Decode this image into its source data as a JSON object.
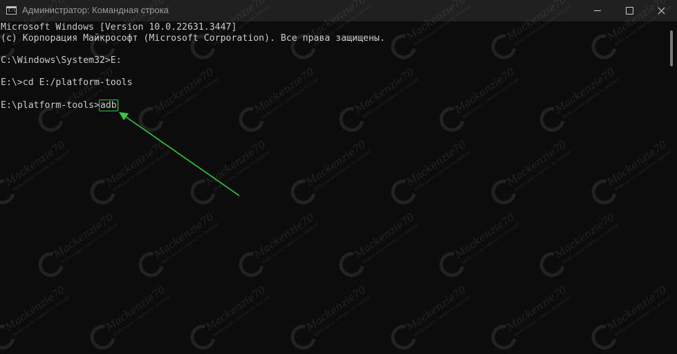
{
  "window": {
    "title": "Администратор: Командная строка",
    "icon": "cmd-icon",
    "icon_text": "C:\\"
  },
  "controls": {
    "minimize": "minimize-icon",
    "maximize": "maximize-icon",
    "close": "close-icon"
  },
  "console": {
    "lines": [
      "Microsoft Windows [Version 10.0.22631.3447]",
      "(c) Корпорация Майкрософт (Microsoft Corporation). Все права защищены.",
      "C:\\Windows\\System32>E:",
      "E:\\>cd E:/platform-tools"
    ],
    "current_prompt": "E:\\platform-tools>",
    "current_command": "adb"
  },
  "annotation": {
    "highlight_color": "#2ecc40",
    "arrow_color": "#2ecc40"
  },
  "watermark": {
    "text": "Mackenzie70",
    "subtext": "Мобильные советы по Android"
  },
  "colors": {
    "titlebar": "#202020",
    "console_bg": "#0c0c0c",
    "console_text": "#cccccc"
  }
}
